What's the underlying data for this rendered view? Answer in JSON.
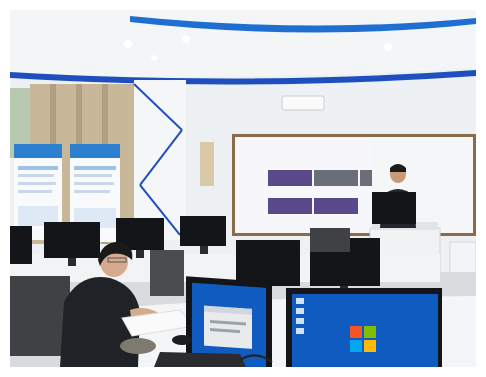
{
  "scene": {
    "type": "photo",
    "setting": "computer-classroom"
  },
  "colors": {
    "ceiling_blue": "#1e6fd1",
    "ceiling_white": "#f3f5f6",
    "wall_white": "#eef1f3",
    "floor": "#d9dcde",
    "monitor_black": "#141518",
    "desktop_blue": "#0f5bbf",
    "dialog_gray": "#e8eaec",
    "projection_purple": "#5a4a8c",
    "projection_gray": "#6b6e7a",
    "banner_blue": "#2d7fd0",
    "chair_gray": "#3f4145",
    "wood_frame": "#8a6b4a"
  }
}
